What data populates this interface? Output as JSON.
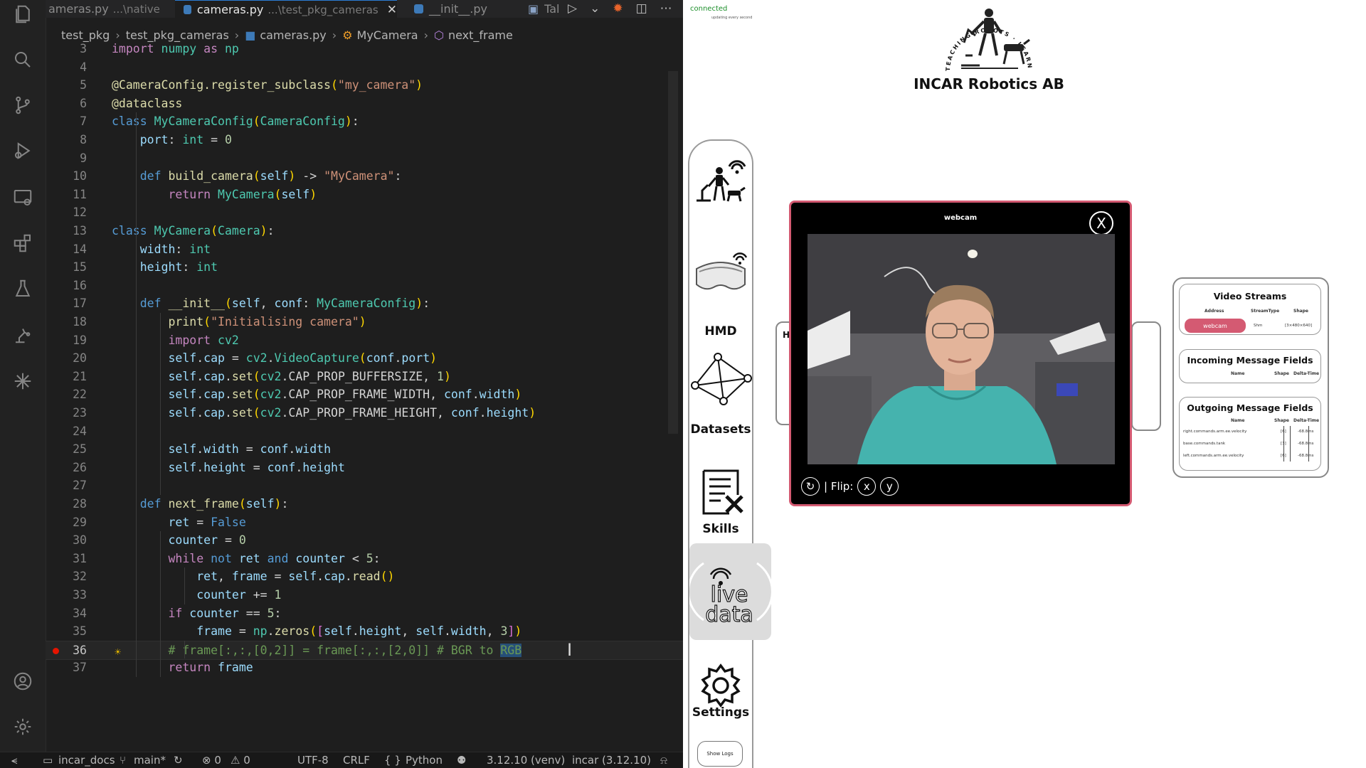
{
  "vscode": {
    "tabs": [
      {
        "label": "ameras.py",
        "path": "...\\native",
        "active": false
      },
      {
        "label": "cameras.py",
        "path": "...\\test_pkg_cameras",
        "active": true
      },
      {
        "label": "__init__.py",
        "path": "",
        "active": false
      },
      {
        "label": "Tal",
        "path": "",
        "active": false
      }
    ],
    "tab_tools": [
      "▷",
      "⌄",
      "✹",
      "◫",
      "⋯"
    ],
    "breadcrumb": [
      "test_pkg",
      "test_pkg_cameras",
      "cameras.py",
      "MyCamera",
      "next_frame"
    ],
    "code_lines": [
      {
        "n": "3",
        "html": "<span class='c'>import</span><span class='d'> </span><span class='cl'>numpy</span><span class='d'> </span><span class='c'>as</span><span class='d'> </span><span class='cl'>np</span>"
      },
      {
        "n": "4",
        "html": ""
      },
      {
        "n": "5",
        "html": "<span class='dec'>@CameraConfig.register_subclass</span><span class='y1'>(</span><span class='s'>\"my_camera\"</span><span class='y1'>)</span>"
      },
      {
        "n": "6",
        "html": "<span class='dec'>@dataclass</span>"
      },
      {
        "n": "7",
        "html": "<span class='k'>class</span><span class='d'> </span><span class='cl'>MyCameraConfig</span><span class='y1'>(</span><span class='cl'>CameraConfig</span><span class='y1'>)</span><span class='d'>:</span>"
      },
      {
        "n": "8",
        "html": "<span class='d'>    </span><span class='p'>port</span><span class='d'>: </span><span class='cl'>int</span><span class='d'> = </span><span class='n'>0</span>"
      },
      {
        "n": "9",
        "html": ""
      },
      {
        "n": "10",
        "html": "<span class='d'>    </span><span class='k'>def</span><span class='d'> </span><span class='f'>build_camera</span><span class='y1'>(</span><span class='p'>self</span><span class='y1'>)</span><span class='d'> -&gt; </span><span class='s'>\"MyCamera\"</span><span class='d'>:</span>"
      },
      {
        "n": "11",
        "html": "<span class='d'>        </span><span class='c'>return</span><span class='d'> </span><span class='cl'>MyCamera</span><span class='y1'>(</span><span class='p'>self</span><span class='y1'>)</span>"
      },
      {
        "n": "12",
        "html": ""
      },
      {
        "n": "13",
        "html": "<span class='k'>class</span><span class='d'> </span><span class='cl'>MyCamera</span><span class='y1'>(</span><span class='cl'>Camera</span><span class='y1'>)</span><span class='d'>:</span>"
      },
      {
        "n": "14",
        "html": "<span class='d'>    </span><span class='p'>width</span><span class='d'>: </span><span class='cl'>int</span>"
      },
      {
        "n": "15",
        "html": "<span class='d'>    </span><span class='p'>height</span><span class='d'>: </span><span class='cl'>int</span>"
      },
      {
        "n": "16",
        "html": ""
      },
      {
        "n": "17",
        "html": "<span class='d'>    </span><span class='k'>def</span><span class='d'> </span><span class='f'>__init__</span><span class='y1'>(</span><span class='p'>self</span><span class='d'>, </span><span class='p'>conf</span><span class='d'>: </span><span class='cl'>MyCameraConfig</span><span class='y1'>)</span><span class='d'>:</span>"
      },
      {
        "n": "18",
        "html": "<span class='d'>        </span><span class='f'>print</span><span class='y1'>(</span><span class='s'>\"Initialising camera\"</span><span class='y1'>)</span>"
      },
      {
        "n": "19",
        "html": "<span class='d'>        </span><span class='c'>import</span><span class='d'> </span><span class='cl'>cv2</span>"
      },
      {
        "n": "20",
        "html": "<span class='d'>        </span><span class='p'>self</span><span class='d'>.</span><span class='p'>cap</span><span class='d'> = </span><span class='cl'>cv2</span><span class='d'>.</span><span class='cl'>VideoCapture</span><span class='y1'>(</span><span class='p'>conf</span><span class='d'>.</span><span class='p'>port</span><span class='y1'>)</span>"
      },
      {
        "n": "21",
        "html": "<span class='d'>        </span><span class='p'>self</span><span class='d'>.</span><span class='p'>cap</span><span class='d'>.</span><span class='f'>set</span><span class='y1'>(</span><span class='cl'>cv2</span><span class='d'>.</span><span class='d'>CAP_PROP_BUFFERSIZE, </span><span class='n'>1</span><span class='y1'>)</span>"
      },
      {
        "n": "22",
        "html": "<span class='d'>        </span><span class='p'>self</span><span class='d'>.</span><span class='p'>cap</span><span class='d'>.</span><span class='f'>set</span><span class='y1'>(</span><span class='cl'>cv2</span><span class='d'>.</span><span class='d'>CAP_PROP_FRAME_WIDTH, </span><span class='p'>conf</span><span class='d'>.</span><span class='p'>width</span><span class='y1'>)</span>"
      },
      {
        "n": "23",
        "html": "<span class='d'>        </span><span class='p'>self</span><span class='d'>.</span><span class='p'>cap</span><span class='d'>.</span><span class='f'>set</span><span class='y1'>(</span><span class='cl'>cv2</span><span class='d'>.</span><span class='d'>CAP_PROP_FRAME_HEIGHT, </span><span class='p'>conf</span><span class='d'>.</span><span class='p'>height</span><span class='y1'>)</span>"
      },
      {
        "n": "24",
        "html": ""
      },
      {
        "n": "25",
        "html": "<span class='d'>        </span><span class='p'>self</span><span class='d'>.</span><span class='p'>width</span><span class='d'> = </span><span class='p'>conf</span><span class='d'>.</span><span class='p'>width</span>"
      },
      {
        "n": "26",
        "html": "<span class='d'>        </span><span class='p'>self</span><span class='d'>.</span><span class='p'>height</span><span class='d'> = </span><span class='p'>conf</span><span class='d'>.</span><span class='p'>height</span>"
      },
      {
        "n": "27",
        "html": ""
      },
      {
        "n": "28",
        "html": "<span class='d'>    </span><span class='k'>def</span><span class='d'> </span><span class='f'>next_frame</span><span class='y1'>(</span><span class='p'>self</span><span class='y1'>)</span><span class='d'>:</span>"
      },
      {
        "n": "29",
        "html": "<span class='d'>        </span><span class='p'>ret</span><span class='d'> = </span><span class='k'>False</span>"
      },
      {
        "n": "30",
        "html": "<span class='d'>        </span><span class='p'>counter</span><span class='d'> = </span><span class='n'>0</span>"
      },
      {
        "n": "31",
        "html": "<span class='d'>        </span><span class='c'>while</span><span class='d'> </span><span class='k'>not</span><span class='d'> </span><span class='p'>ret</span><span class='d'> </span><span class='k'>and</span><span class='d'> </span><span class='p'>counter</span><span class='d'> &lt; </span><span class='n'>5</span><span class='d'>:</span>"
      },
      {
        "n": "32",
        "html": "<span class='d'>            </span><span class='p'>ret</span><span class='d'>, </span><span class='p'>frame</span><span class='d'> = </span><span class='p'>self</span><span class='d'>.</span><span class='p'>cap</span><span class='d'>.</span><span class='f'>read</span><span class='y1'>()</span>"
      },
      {
        "n": "33",
        "html": "<span class='d'>            </span><span class='p'>counter</span><span class='d'> += </span><span class='n'>1</span>"
      },
      {
        "n": "34",
        "html": "<span class='d'>        </span><span class='c'>if</span><span class='d'> </span><span class='p'>counter</span><span class='d'> == </span><span class='n'>5</span><span class='d'>:</span>"
      },
      {
        "n": "35",
        "html": "<span class='d'>            </span><span class='p'>frame</span><span class='d'> = </span><span class='cl'>np</span><span class='d'>.</span><span class='f'>zeros</span><span class='y1'>(</span><span class='y2'>[</span><span class='p'>self</span><span class='d'>.</span><span class='p'>height</span><span class='d'>, </span><span class='p'>self</span><span class='d'>.</span><span class='p'>width</span><span class='d'>, </span><span class='n'>3</span><span class='y2'>]</span><span class='y1'>)</span>"
      },
      {
        "n": "36",
        "html": "<span class='d'>        </span><span class='cm'># frame[:,:,[0,2]] = frame[:,:,[2,0]] # BGR to </span><span class='cm sel'>RGB</span>"
      },
      {
        "n": "37",
        "html": "<span class='d'>        </span><span class='c'>return</span><span class='d'> </span><span class='p'>frame</span>"
      }
    ],
    "status": {
      "remote": "⪪",
      "repo": "incar_docs",
      "branch": "main*",
      "sync": "↻",
      "errors": "⊗ 0",
      "warnings": "⚠ 0",
      "encoding": "UTF-8",
      "eol": "CRLF",
      "language": "Python",
      "copilot": "⚉",
      "interpreter": "3.12.10 (venv)",
      "env": "incar (3.12.10)",
      "bell": "⍾"
    }
  },
  "app": {
    "connection": "connected",
    "connection_sub": "updating every second",
    "logo_ring_text": "TEACHING ROBOTS · LEARNING HUMANS",
    "brand": "INCAR Robotics AB",
    "nav": [
      {
        "id": "robot",
        "label": ""
      },
      {
        "id": "hmd",
        "label": "HMD"
      },
      {
        "id": "datasets",
        "label": "Datasets"
      },
      {
        "id": "skills",
        "label": "Skills"
      },
      {
        "id": "live",
        "label": "live\ndata"
      },
      {
        "id": "settings",
        "label": "Settings"
      }
    ],
    "show_logs": "Show Logs",
    "behind_letter": "H",
    "webcam_modal": {
      "title": "webcam",
      "close": "X",
      "rotate": "↻",
      "flip_label": "| Flip:",
      "flip_x": "x",
      "flip_y": "y"
    },
    "video_streams": {
      "title": "Video Streams",
      "columns": [
        "Address",
        "StreamType",
        "Shape"
      ],
      "rows": [
        {
          "address": "webcam",
          "type": "Shm",
          "shape": "[3×480×640]"
        }
      ]
    },
    "incoming_fields": {
      "title": "Incoming Message Fields",
      "columns": [
        "Name",
        "Shape",
        "Delta-Time"
      ]
    },
    "outgoing_fields": {
      "title": "Outgoing Message Fields",
      "columns": [
        "Name",
        "Shape",
        "Delta-Time"
      ],
      "rows": [
        {
          "name": "right.commands.arm.ee.velocity",
          "shape": "[6]",
          "dt": "-68.8ms"
        },
        {
          "name": "base.commands.tank",
          "shape": "[3]",
          "dt": "-68.8ms"
        },
        {
          "name": "left.commands.arm.ee.velocity",
          "shape": "[6]",
          "dt": "-68.8ms"
        }
      ]
    },
    "colors": {
      "accent": "#d45a72",
      "connected": "#1c8f2a"
    }
  }
}
